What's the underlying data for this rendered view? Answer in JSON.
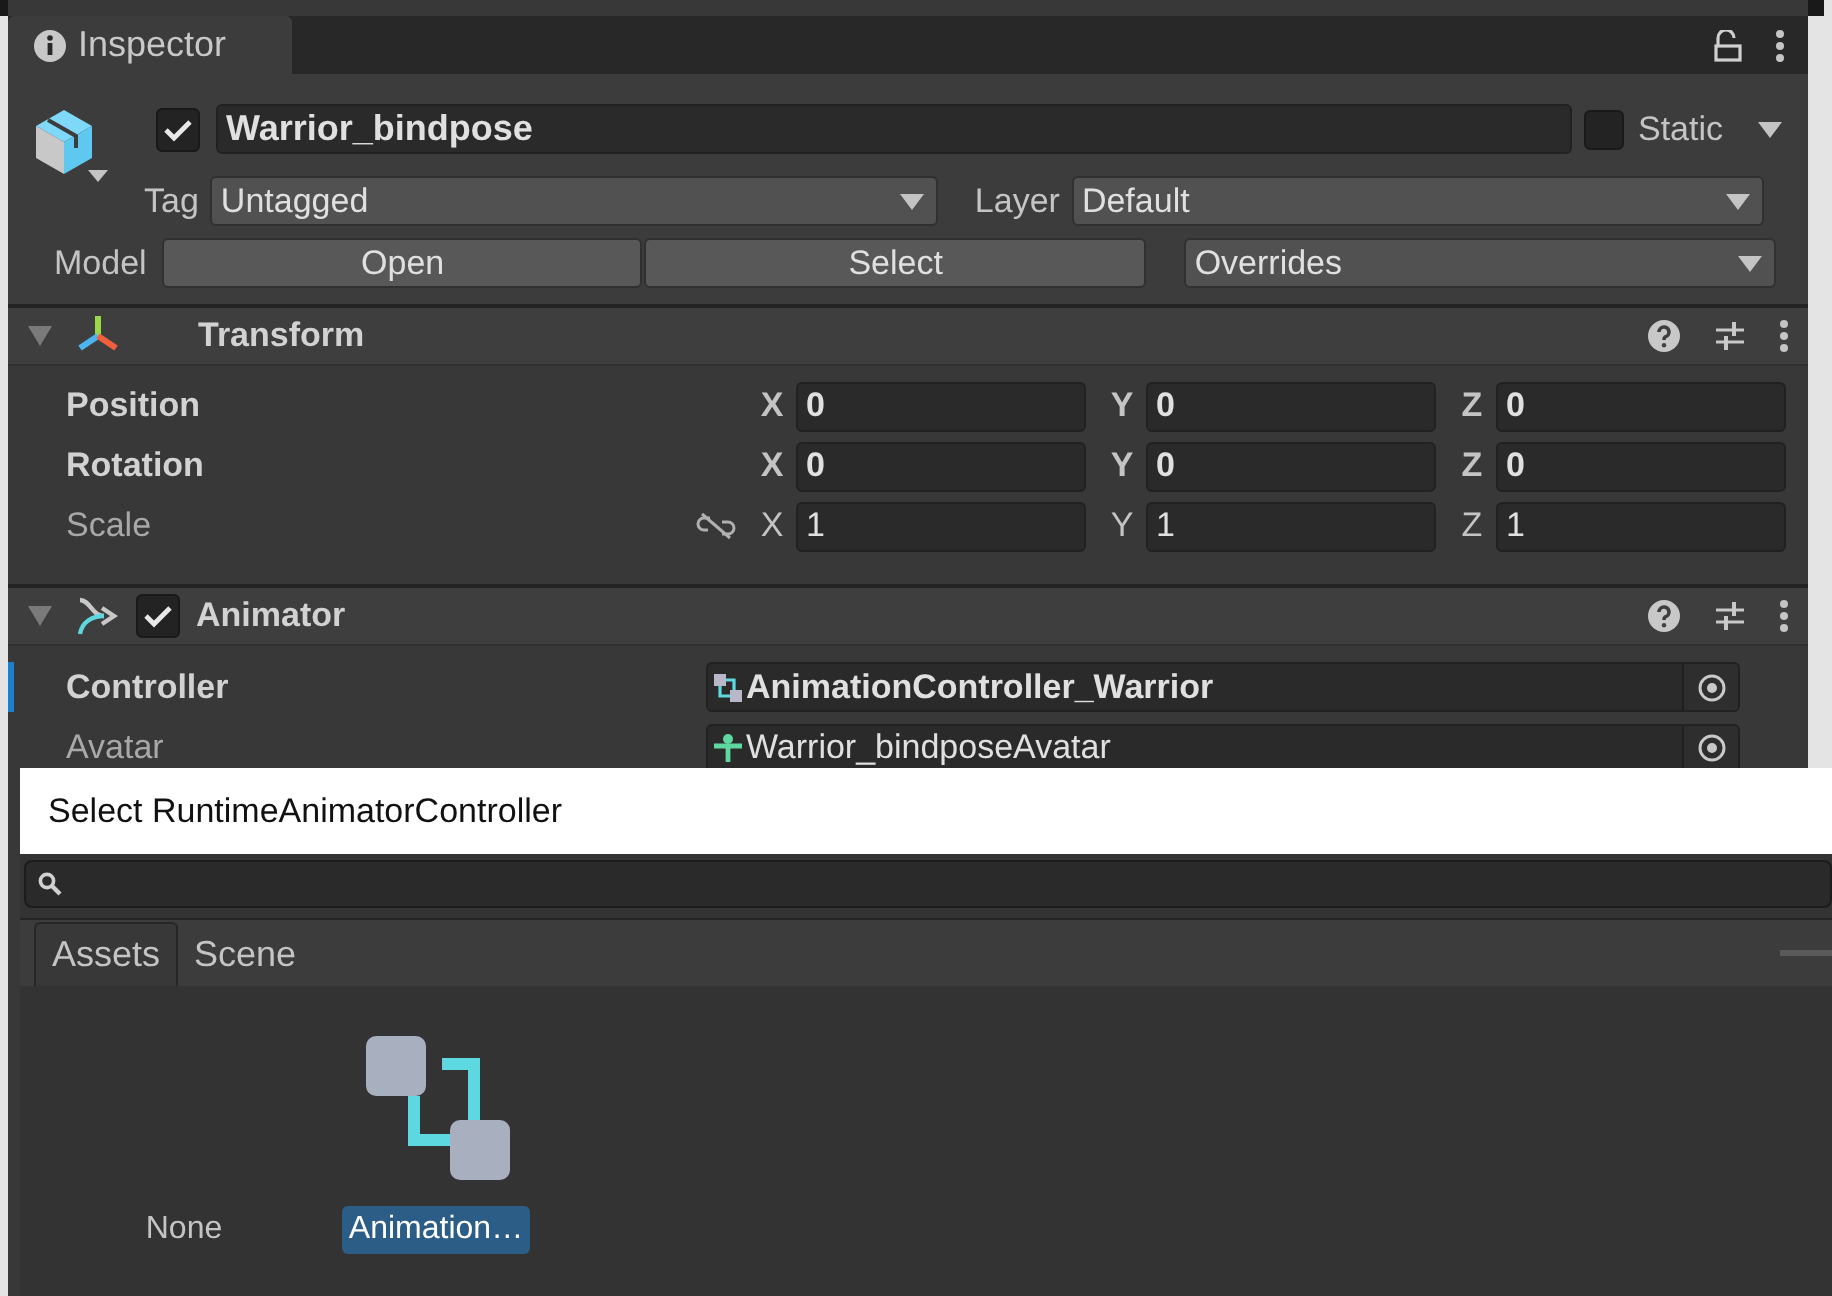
{
  "tab": {
    "label": "Inspector"
  },
  "object": {
    "active": true,
    "name": "Warrior_bindpose",
    "static": false,
    "static_label": "Static",
    "tag_label": "Tag",
    "tag": "Untagged",
    "layer_label": "Layer",
    "layer": "Default",
    "model_label": "Model",
    "model_buttons": [
      "Open",
      "Select"
    ],
    "overrides": "Overrides"
  },
  "components": [
    {
      "kind": "transform",
      "title": "Transform",
      "expanded": true,
      "rows": [
        {
          "label": "Position",
          "modified": true,
          "values": [
            {
              "axis": "X",
              "value": "0"
            },
            {
              "axis": "Y",
              "value": "0"
            },
            {
              "axis": "Z",
              "value": "0"
            }
          ]
        },
        {
          "label": "Rotation",
          "modified": true,
          "values": [
            {
              "axis": "X",
              "value": "0"
            },
            {
              "axis": "Y",
              "value": "0"
            },
            {
              "axis": "Z",
              "value": "0"
            }
          ]
        },
        {
          "label": "Scale",
          "modified": false,
          "constrained": false,
          "values": [
            {
              "axis": "X",
              "value": "1"
            },
            {
              "axis": "Y",
              "value": "1"
            },
            {
              "axis": "Z",
              "value": "1"
            }
          ]
        }
      ]
    },
    {
      "kind": "animator",
      "title": "Animator",
      "expanded": true,
      "enabled": true,
      "fields": [
        {
          "label": "Controller",
          "modified": true,
          "value": "AnimationController_Warrior"
        },
        {
          "label": "Avatar",
          "modified": false,
          "value": "Warrior_bindposeAvatar"
        }
      ]
    }
  ],
  "picker": {
    "title": "Select RuntimeAnimatorController",
    "tabs": [
      {
        "label": "Assets",
        "selected": true
      },
      {
        "label": "Scene",
        "selected": false
      }
    ],
    "items": [
      {
        "kind": "none",
        "label": "None",
        "selected": false
      },
      {
        "kind": "controller",
        "label": "Animation…",
        "selected": true
      }
    ]
  }
}
